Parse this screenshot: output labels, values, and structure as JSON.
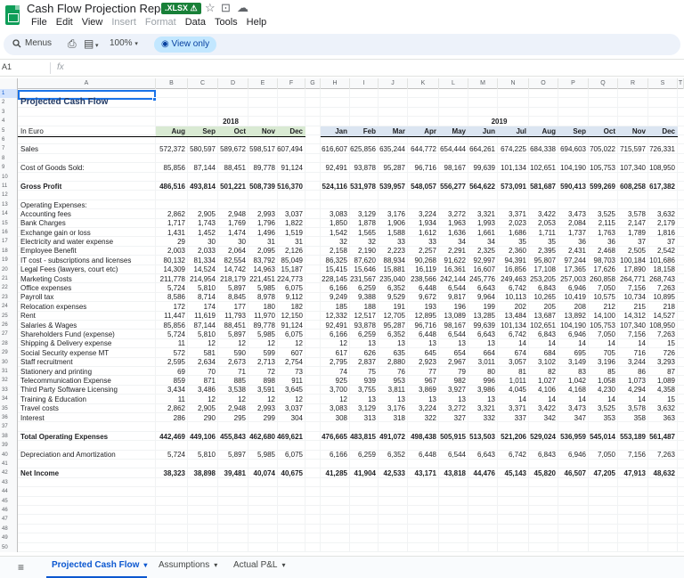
{
  "title_bar": {
    "doc_title": "Cash Flow Projection Report",
    "badge": ".XLSX ⚠",
    "icons": [
      "star-icon",
      "move-to-folder-icon",
      "cloud-status-icon"
    ]
  },
  "menu": [
    {
      "label": "File",
      "enabled": true
    },
    {
      "label": "Edit",
      "enabled": true
    },
    {
      "label": "View",
      "enabled": true
    },
    {
      "label": "Insert",
      "enabled": false
    },
    {
      "label": "Format",
      "enabled": false
    },
    {
      "label": "Data",
      "enabled": true
    },
    {
      "label": "Tools",
      "enabled": true
    },
    {
      "label": "Help",
      "enabled": true
    }
  ],
  "toolbar": {
    "menus_label": "Menus",
    "zoom": "100%",
    "view_only_label": "View only"
  },
  "formula_bar": {
    "name_box": "A1",
    "fx": "fx",
    "content": ""
  },
  "columns": [
    "A",
    "B",
    "C",
    "D",
    "E",
    "F",
    "G",
    "H",
    "I",
    "J",
    "K",
    "L",
    "M",
    "N",
    "O",
    "P",
    "Q",
    "R",
    "S",
    "T",
    "U"
  ],
  "sheet": {
    "title": "Projected Cash Flow",
    "unit_label": "In Euro",
    "years": [
      "2018",
      "2019"
    ],
    "months_2018": [
      "Aug",
      "Sep",
      "Oct",
      "Nov",
      "Dec"
    ],
    "months_2019": [
      "Jan",
      "Feb",
      "Mar",
      "Apr",
      "May",
      "Jun",
      "Jul",
      "Aug",
      "Sep",
      "Oct",
      "Nov",
      "Dec"
    ],
    "operating_expenses_header": "Operating Expenses:",
    "rows": [
      {
        "row": 7,
        "label": "Sales",
        "bold": false,
        "values": [
          "572,372",
          "580,597",
          "589,672",
          "598,517",
          "607,494",
          "616,607",
          "625,856",
          "635,244",
          "644,772",
          "654,444",
          "664,261",
          "674,225",
          "684,338",
          "694,603",
          "705,022",
          "715,597",
          "726,331"
        ]
      },
      {
        "row": 9,
        "label": "Cost of Goods Sold:",
        "bold": false,
        "values": [
          "85,856",
          "87,144",
          "88,451",
          "89,778",
          "91,124",
          "92,491",
          "93,878",
          "95,287",
          "96,716",
          "98,167",
          "99,639",
          "101,134",
          "102,651",
          "104,190",
          "105,753",
          "107,340",
          "108,950"
        ]
      },
      {
        "row": 11,
        "label": "Gross Profit",
        "bold": true,
        "values": [
          "486,516",
          "493,814",
          "501,221",
          "508,739",
          "516,370",
          "524,116",
          "531,978",
          "539,957",
          "548,057",
          "556,277",
          "564,622",
          "573,091",
          "581,687",
          "590,413",
          "599,269",
          "608,258",
          "617,382"
        ]
      },
      {
        "row": 14,
        "label": "Accounting fees",
        "bold": false,
        "values": [
          "2,862",
          "2,905",
          "2,948",
          "2,993",
          "3,037",
          "3,083",
          "3,129",
          "3,176",
          "3,224",
          "3,272",
          "3,321",
          "3,371",
          "3,422",
          "3,473",
          "3,525",
          "3,578",
          "3,632"
        ]
      },
      {
        "row": 15,
        "label": "Bank Charges",
        "bold": false,
        "values": [
          "1,717",
          "1,743",
          "1,769",
          "1,796",
          "1,822",
          "1,850",
          "1,878",
          "1,906",
          "1,934",
          "1,963",
          "1,993",
          "2,023",
          "2,053",
          "2,084",
          "2,115",
          "2,147",
          "2,179"
        ]
      },
      {
        "row": 16,
        "label": "Exchange gain or loss",
        "bold": false,
        "values": [
          "1,431",
          "1,452",
          "1,474",
          "1,496",
          "1,519",
          "1,542",
          "1,565",
          "1,588",
          "1,612",
          "1,636",
          "1,661",
          "1,686",
          "1,711",
          "1,737",
          "1,763",
          "1,789",
          "1,816"
        ]
      },
      {
        "row": 17,
        "label": "Electricity and water expense",
        "bold": false,
        "values": [
          "29",
          "30",
          "30",
          "31",
          "31",
          "32",
          "32",
          "33",
          "33",
          "34",
          "34",
          "35",
          "35",
          "36",
          "36",
          "37",
          "37"
        ]
      },
      {
        "row": 18,
        "label": "Employee Benefit",
        "bold": false,
        "values": [
          "2,003",
          "2,033",
          "2,064",
          "2,095",
          "2,126",
          "2,158",
          "2,190",
          "2,223",
          "2,257",
          "2,291",
          "2,325",
          "2,360",
          "2,395",
          "2,431",
          "2,468",
          "2,505",
          "2,542"
        ]
      },
      {
        "row": 19,
        "label": "IT cost - subscriptions and licenses",
        "bold": false,
        "values": [
          "80,132",
          "81,334",
          "82,554",
          "83,792",
          "85,049",
          "86,325",
          "87,620",
          "88,934",
          "90,268",
          "91,622",
          "92,997",
          "94,391",
          "95,807",
          "97,244",
          "98,703",
          "100,184",
          "101,686"
        ]
      },
      {
        "row": 20,
        "label": "Legal Fees (lawyers, court etc)",
        "bold": false,
        "values": [
          "14,309",
          "14,524",
          "14,742",
          "14,963",
          "15,187",
          "15,415",
          "15,646",
          "15,881",
          "16,119",
          "16,361",
          "16,607",
          "16,856",
          "17,108",
          "17,365",
          "17,626",
          "17,890",
          "18,158"
        ]
      },
      {
        "row": 21,
        "label": "Marketing Costs",
        "bold": false,
        "values": [
          "211,778",
          "214,954",
          "218,179",
          "221,451",
          "224,773",
          "228,145",
          "231,567",
          "235,040",
          "238,566",
          "242,144",
          "245,776",
          "249,463",
          "253,205",
          "257,003",
          "260,858",
          "264,771",
          "268,743"
        ]
      },
      {
        "row": 22,
        "label": "Office expenses",
        "bold": false,
        "values": [
          "5,724",
          "5,810",
          "5,897",
          "5,985",
          "6,075",
          "6,166",
          "6,259",
          "6,352",
          "6,448",
          "6,544",
          "6,643",
          "6,742",
          "6,843",
          "6,946",
          "7,050",
          "7,156",
          "7,263"
        ]
      },
      {
        "row": 23,
        "label": "Payroll tax",
        "bold": false,
        "values": [
          "8,586",
          "8,714",
          "8,845",
          "8,978",
          "9,112",
          "9,249",
          "9,388",
          "9,529",
          "9,672",
          "9,817",
          "9,964",
          "10,113",
          "10,265",
          "10,419",
          "10,575",
          "10,734",
          "10,895"
        ]
      },
      {
        "row": 24,
        "label": "Relocation expenses",
        "bold": false,
        "values": [
          "172",
          "174",
          "177",
          "180",
          "182",
          "185",
          "188",
          "191",
          "193",
          "196",
          "199",
          "202",
          "205",
          "208",
          "212",
          "215",
          "218"
        ]
      },
      {
        "row": 25,
        "label": "Rent",
        "bold": false,
        "values": [
          "11,447",
          "11,619",
          "11,793",
          "11,970",
          "12,150",
          "12,332",
          "12,517",
          "12,705",
          "12,895",
          "13,089",
          "13,285",
          "13,484",
          "13,687",
          "13,892",
          "14,100",
          "14,312",
          "14,527"
        ]
      },
      {
        "row": 26,
        "label": "Salaries & Wages",
        "bold": false,
        "values": [
          "85,856",
          "87,144",
          "88,451",
          "89,778",
          "91,124",
          "92,491",
          "93,878",
          "95,287",
          "96,716",
          "98,167",
          "99,639",
          "101,134",
          "102,651",
          "104,190",
          "105,753",
          "107,340",
          "108,950"
        ]
      },
      {
        "row": 27,
        "label": "Shareholders Fund (expense)",
        "bold": false,
        "values": [
          "5,724",
          "5,810",
          "5,897",
          "5,985",
          "6,075",
          "6,166",
          "6,259",
          "6,352",
          "6,448",
          "6,544",
          "6,643",
          "6,742",
          "6,843",
          "6,946",
          "7,050",
          "7,156",
          "7,263"
        ]
      },
      {
        "row": 28,
        "label": "Shipping & Delivery expense",
        "bold": false,
        "values": [
          "11",
          "12",
          "12",
          "12",
          "12",
          "12",
          "13",
          "13",
          "13",
          "13",
          "13",
          "14",
          "14",
          "14",
          "14",
          "14",
          "15"
        ]
      },
      {
        "row": 29,
        "label": "Social Security expense MT",
        "bold": false,
        "values": [
          "572",
          "581",
          "590",
          "599",
          "607",
          "617",
          "626",
          "635",
          "645",
          "654",
          "664",
          "674",
          "684",
          "695",
          "705",
          "716",
          "726"
        ]
      },
      {
        "row": 30,
        "label": "Staff recruitment",
        "bold": false,
        "values": [
          "2,595",
          "2,634",
          "2,673",
          "2,713",
          "2,754",
          "2,795",
          "2,837",
          "2,880",
          "2,923",
          "2,967",
          "3,011",
          "3,057",
          "3,102",
          "3,149",
          "3,196",
          "3,244",
          "3,293"
        ]
      },
      {
        "row": 31,
        "label": "Stationery and printing",
        "bold": false,
        "values": [
          "69",
          "70",
          "71",
          "72",
          "73",
          "74",
          "75",
          "76",
          "77",
          "79",
          "80",
          "81",
          "82",
          "83",
          "85",
          "86",
          "87"
        ]
      },
      {
        "row": 32,
        "label": "Telecommunication Expense",
        "bold": false,
        "values": [
          "859",
          "871",
          "885",
          "898",
          "911",
          "925",
          "939",
          "953",
          "967",
          "982",
          "996",
          "1,011",
          "1,027",
          "1,042",
          "1,058",
          "1,073",
          "1,089"
        ]
      },
      {
        "row": 33,
        "label": "Third Party Software Licensing",
        "bold": false,
        "values": [
          "3,434",
          "3,486",
          "3,538",
          "3,591",
          "3,645",
          "3,700",
          "3,755",
          "3,811",
          "3,869",
          "3,927",
          "3,986",
          "4,045",
          "4,106",
          "4,168",
          "4,230",
          "4,294",
          "4,358"
        ]
      },
      {
        "row": 34,
        "label": "Training & Education",
        "bold": false,
        "values": [
          "11",
          "12",
          "12",
          "12",
          "12",
          "12",
          "13",
          "13",
          "13",
          "13",
          "13",
          "14",
          "14",
          "14",
          "14",
          "14",
          "15"
        ]
      },
      {
        "row": 35,
        "label": "Travel costs",
        "bold": false,
        "values": [
          "2,862",
          "2,905",
          "2,948",
          "2,993",
          "3,037",
          "3,083",
          "3,129",
          "3,176",
          "3,224",
          "3,272",
          "3,321",
          "3,371",
          "3,422",
          "3,473",
          "3,525",
          "3,578",
          "3,632"
        ]
      },
      {
        "row": 36,
        "label": "Interest",
        "bold": false,
        "values": [
          "286",
          "290",
          "295",
          "299",
          "304",
          "308",
          "313",
          "318",
          "322",
          "327",
          "332",
          "337",
          "342",
          "347",
          "353",
          "358",
          "363"
        ]
      },
      {
        "row": 38,
        "label": "Total Operating Expenses",
        "bold": true,
        "values": [
          "442,469",
          "449,106",
          "455,843",
          "462,680",
          "469,621",
          "476,665",
          "483,815",
          "491,072",
          "498,438",
          "505,915",
          "513,503",
          "521,206",
          "529,024",
          "536,959",
          "545,014",
          "553,189",
          "561,487"
        ]
      },
      {
        "row": 40,
        "label": "Depreciation and Amortization",
        "bold": false,
        "values": [
          "5,724",
          "5,810",
          "5,897",
          "5,985",
          "6,075",
          "6,166",
          "6,259",
          "6,352",
          "6,448",
          "6,544",
          "6,643",
          "6,742",
          "6,843",
          "6,946",
          "7,050",
          "7,156",
          "7,263"
        ]
      },
      {
        "row": 42,
        "label": "Net Income",
        "bold": true,
        "values": [
          "38,323",
          "38,898",
          "39,481",
          "40,074",
          "40,675",
          "41,285",
          "41,904",
          "42,533",
          "43,171",
          "43,818",
          "44,476",
          "45,143",
          "45,820",
          "46,507",
          "47,205",
          "47,913",
          "48,632"
        ]
      }
    ]
  },
  "colors": {
    "band_2018": "#d9ead3",
    "band_2019": "#dbe5f1",
    "title": "#1f3864",
    "selection": "#1a73e8",
    "active_tab": "#0b57d0"
  },
  "tabs": [
    {
      "label": "Projected Cash Flow",
      "active": true
    },
    {
      "label": "Assumptions",
      "active": false
    },
    {
      "label": "Actual P&L",
      "active": false
    }
  ]
}
